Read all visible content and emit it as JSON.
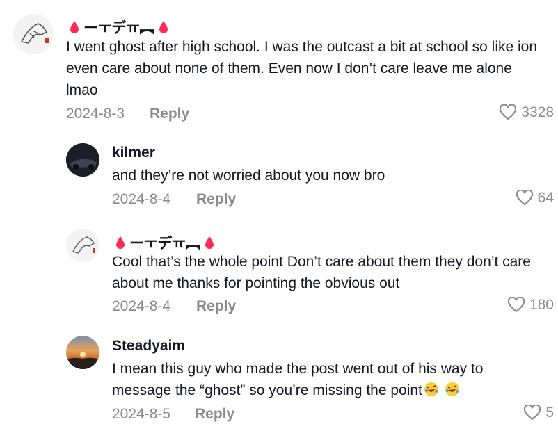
{
  "comments": [
    {
      "username": "ーㅜデㅠ︻",
      "text": "I went ghost after high school. I was the outcast a bit at school so like ion even care about none of them. Even now I don’t care leave me alone lmao",
      "date": "2024-8-3",
      "reply_label": "Reply",
      "likes": "3328"
    },
    {
      "username": "kilmer",
      "text": "and they’re not worried about you now bro",
      "date": "2024-8-4",
      "reply_label": "Reply",
      "likes": "64"
    },
    {
      "username": "ーㅜデㅠ︻",
      "text": "Cool that’s the whole point Don’t care about them they don’t care about me thanks for pointing the obvious out",
      "date": "2024-8-4",
      "reply_label": "Reply",
      "likes": "180"
    },
    {
      "username": "Steadyaim",
      "text": "I mean this guy who made the post went out of his way to message the “ghost” so you’re missing the point",
      "date": "2024-8-5",
      "reply_label": "Reply",
      "likes": "5"
    }
  ],
  "colors": {
    "drop": "#fe2c55",
    "meta": "#8a8b91",
    "text": "#161823"
  },
  "icons": {
    "like": "heart-outline-icon",
    "emoji": "rolling-laughing-emoji"
  }
}
